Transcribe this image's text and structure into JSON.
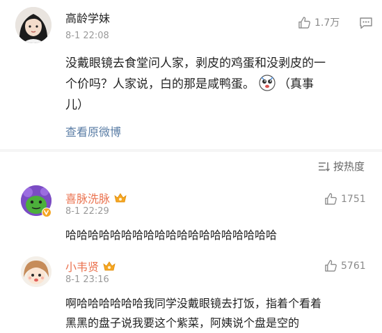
{
  "post": {
    "author": "高龄学妹",
    "time": "8-1 22:08",
    "likes": "1.7万",
    "body_lines": [
      "没戴眼镜去食堂问人家，剥皮的鸡蛋和没剥皮的一",
      "个价吗？人家说，白的那是咸鸭蛋。",
      "（真事",
      "儿）"
    ],
    "view_original": "查看原微博"
  },
  "sort": {
    "label": "按热度"
  },
  "comments": [
    {
      "name": "喜脉洗脉",
      "time": "8-1 22:29",
      "likes": "1751",
      "text": "哈哈哈哈哈哈哈哈哈哈哈哈哈哈哈哈哈哈哈"
    },
    {
      "name": "小韦贤",
      "time": "8-1 23:16",
      "likes": "5761",
      "lines": [
        "啊哈哈哈哈哈哈我同学没戴眼镜去打饭，指着个看着",
        "黑黑的盘子说我要这个紫菜，阿姨说个盘是空的"
      ]
    }
  ],
  "colors": {
    "link": "#5b7ea6",
    "name": "#eb7350",
    "badge": "#f5a623"
  }
}
